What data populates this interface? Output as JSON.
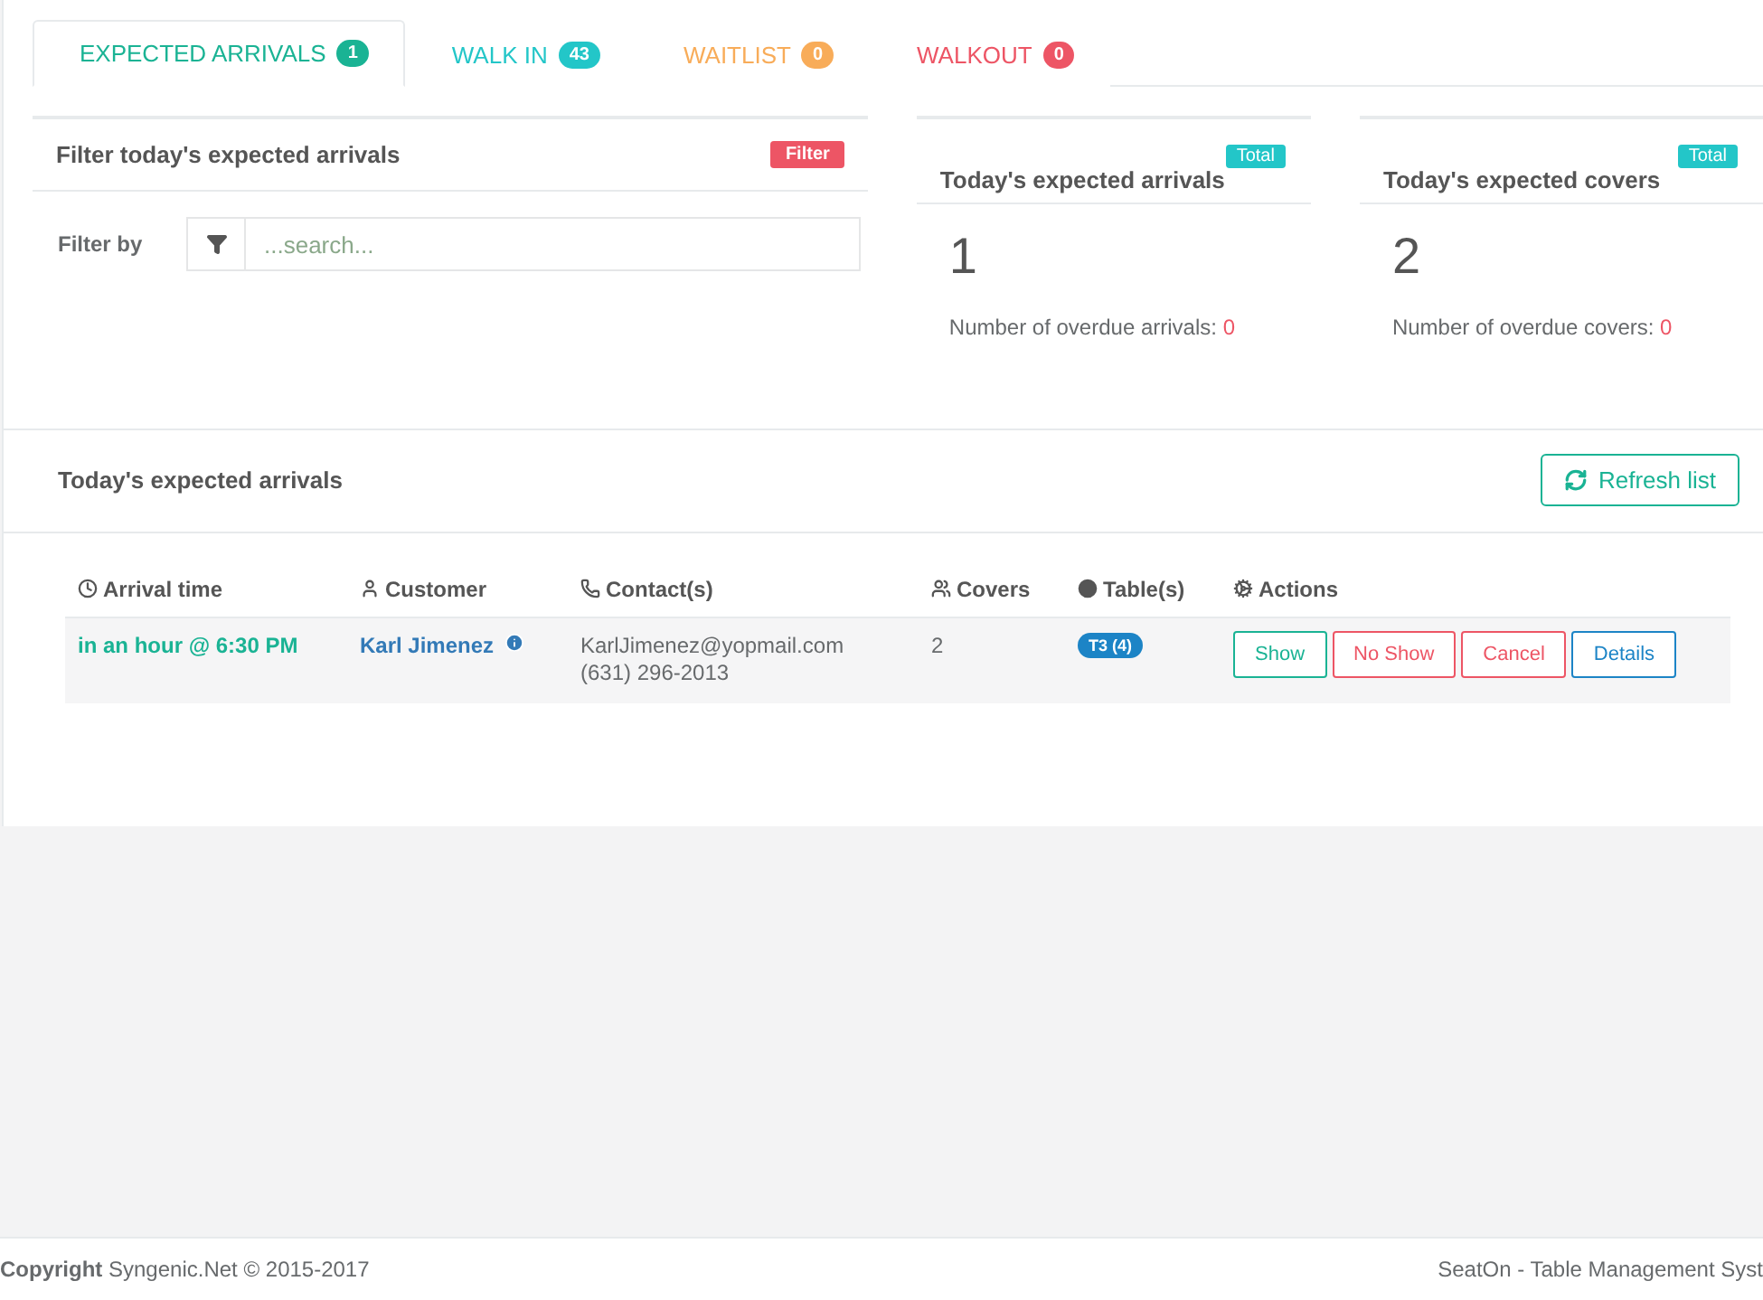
{
  "tabs": [
    {
      "label": "EXPECTED ARRIVALS",
      "count": "1",
      "color": "#1ab394",
      "selected": true
    },
    {
      "label": "WALK IN",
      "count": "43",
      "color": "#23c6c8",
      "selected": false
    },
    {
      "label": "WAITLIST",
      "count": "0",
      "color": "#f8ac59",
      "selected": false
    },
    {
      "label": "WALKOUT",
      "count": "0",
      "color": "#ed5565",
      "selected": false
    }
  ],
  "filter_panel": {
    "title": "Filter today's expected arrivals",
    "badge": "Filter",
    "label": "Filter by",
    "placeholder": "...search..."
  },
  "stats": [
    {
      "badge": "Total",
      "title": "Today's expected arrivals",
      "value": "1",
      "note": "Number of overdue arrivals:",
      "overdue": "0"
    },
    {
      "badge": "Total",
      "title": "Today's expected covers",
      "value": "2",
      "note": "Number of overdue covers:",
      "overdue": "0"
    }
  ],
  "list": {
    "title": "Today's expected arrivals",
    "refresh_button": "Refresh list",
    "columns": [
      "Arrival time",
      "Customer",
      "Contact(s)",
      "Covers",
      "Table(s)",
      "Actions"
    ],
    "rows": [
      {
        "arrival": "in an hour @ 6:30 PM",
        "customer": "Karl Jimenez",
        "email": "KarlJimenez@yopmail.com",
        "phone": "(631) 296-2013",
        "covers": "2",
        "table": "T3 (4)",
        "actions": [
          {
            "label": "Show",
            "color": "#1ab394"
          },
          {
            "label": "No Show",
            "color": "#ed5565"
          },
          {
            "label": "Cancel",
            "color": "#ed5565"
          },
          {
            "label": "Details",
            "color": "#1c84c6"
          }
        ]
      }
    ]
  },
  "footer": {
    "left": "**Copyright** Syngenic.Net © 2015-2017",
    "right": "SeatOn - Table Management Syst"
  }
}
